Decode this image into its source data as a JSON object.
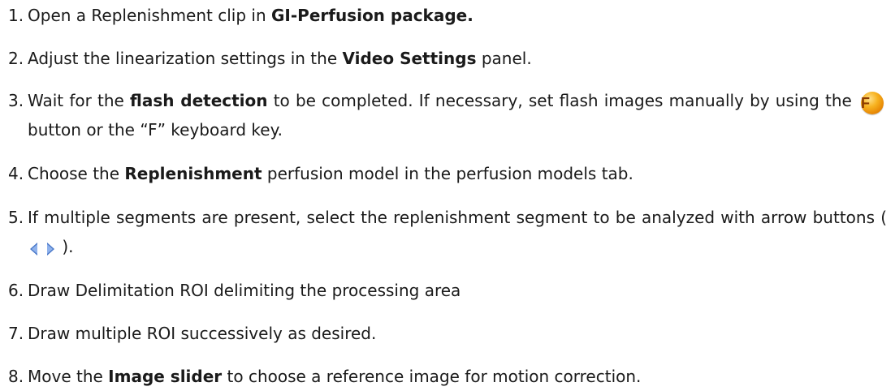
{
  "steps": [
    {
      "number": "1.",
      "parts": [
        "Open a Replenishment clip in ",
        "GI-Perfusion package."
      ]
    },
    {
      "number": "2.",
      "parts": [
        "Adjust the linearization settings in the ",
        "Video Settings",
        " panel."
      ]
    },
    {
      "number": "3.",
      "parts": [
        "Wait for the ",
        "flash detection",
        " to be completed. If necessary, set flash images manually by using the ",
        " button or the “F” keyboard key."
      ],
      "icon_label": "F",
      "icon": "flash-f-icon"
    },
    {
      "number": "4.",
      "parts": [
        "Choose the ",
        "Replenishment",
        " perfusion model in the perfusion models tab."
      ]
    },
    {
      "number": "5.",
      "parts": [
        "If multiple segments are present, select the replenishment segment to be analyzed with arrow buttons (",
        " )."
      ],
      "icons": [
        "arrow-left-icon",
        "arrow-right-icon"
      ],
      "icon_color": "#4a78c8"
    },
    {
      "number": "6.",
      "parts": [
        "Draw Delimitation ROI delimiting the processing area"
      ]
    },
    {
      "number": "7.",
      "parts": [
        "Draw multiple ROI successively as desired."
      ]
    },
    {
      "number": "8.",
      "parts": [
        "Move the ",
        "Image slider",
        " to choose a reference image for motion correction."
      ]
    }
  ]
}
